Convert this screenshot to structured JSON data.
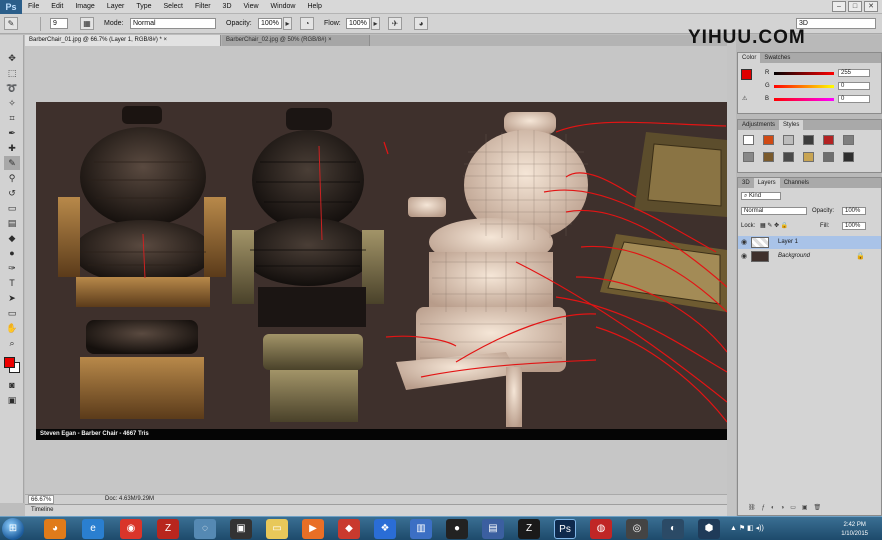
{
  "app": {
    "logo": "Ps"
  },
  "menu": [
    "File",
    "Edit",
    "Image",
    "Layer",
    "Type",
    "Select",
    "Filter",
    "3D",
    "View",
    "Window",
    "Help"
  ],
  "window_controls": [
    "–",
    "□",
    "✕"
  ],
  "options_bar": {
    "size": "9",
    "mode_label": "Mode:",
    "mode_value": "Normal",
    "opacity_label": "Opacity:",
    "opacity_value": "100%",
    "flow_label": "Flow:",
    "flow_value": "100%",
    "workspace": "3D"
  },
  "tabs": [
    {
      "label": "BarberChair_01.jpg @ 66.7% (Layer 1, RGB/8#) *",
      "close": "×"
    },
    {
      "label": "BarberChair_02.jpg @ 50% (RGB/8#)",
      "close": "×"
    }
  ],
  "watermark": {
    "part1": "YIHU",
    "part2": "U.COM"
  },
  "canvas": {
    "caption": "Steven  Egan  -  Barber Chair  -  4667  Tris"
  },
  "status": {
    "zoom": "66.67%",
    "doc": "Doc: 4.63M/9.29M"
  },
  "timeline_label": "Timeline",
  "color_panel": {
    "tabs": [
      "Color",
      "Swatches"
    ],
    "channels": [
      {
        "label": "R",
        "value": "255"
      },
      {
        "label": "G",
        "value": "0"
      },
      {
        "label": "B",
        "value": "0"
      }
    ],
    "fg": "#e00000",
    "bg": "#ffffff"
  },
  "styles_panel": {
    "tabs": [
      "Adjustments",
      "Styles"
    ]
  },
  "layers_panel": {
    "tabs": [
      "3D",
      "Layers",
      "Channels"
    ],
    "kind_label": "Kind",
    "blend": "Normal",
    "opacity_label": "Opacity:",
    "opacity_value": "100%",
    "lock_label": "Lock:",
    "fill_label": "Fill:",
    "fill_value": "100%",
    "layers": [
      {
        "name": "Layer 1",
        "selected": true
      },
      {
        "name": "Background",
        "selected": false
      }
    ]
  },
  "taskbar": {
    "time": "2:42 PM",
    "date": "1/10/2015"
  }
}
